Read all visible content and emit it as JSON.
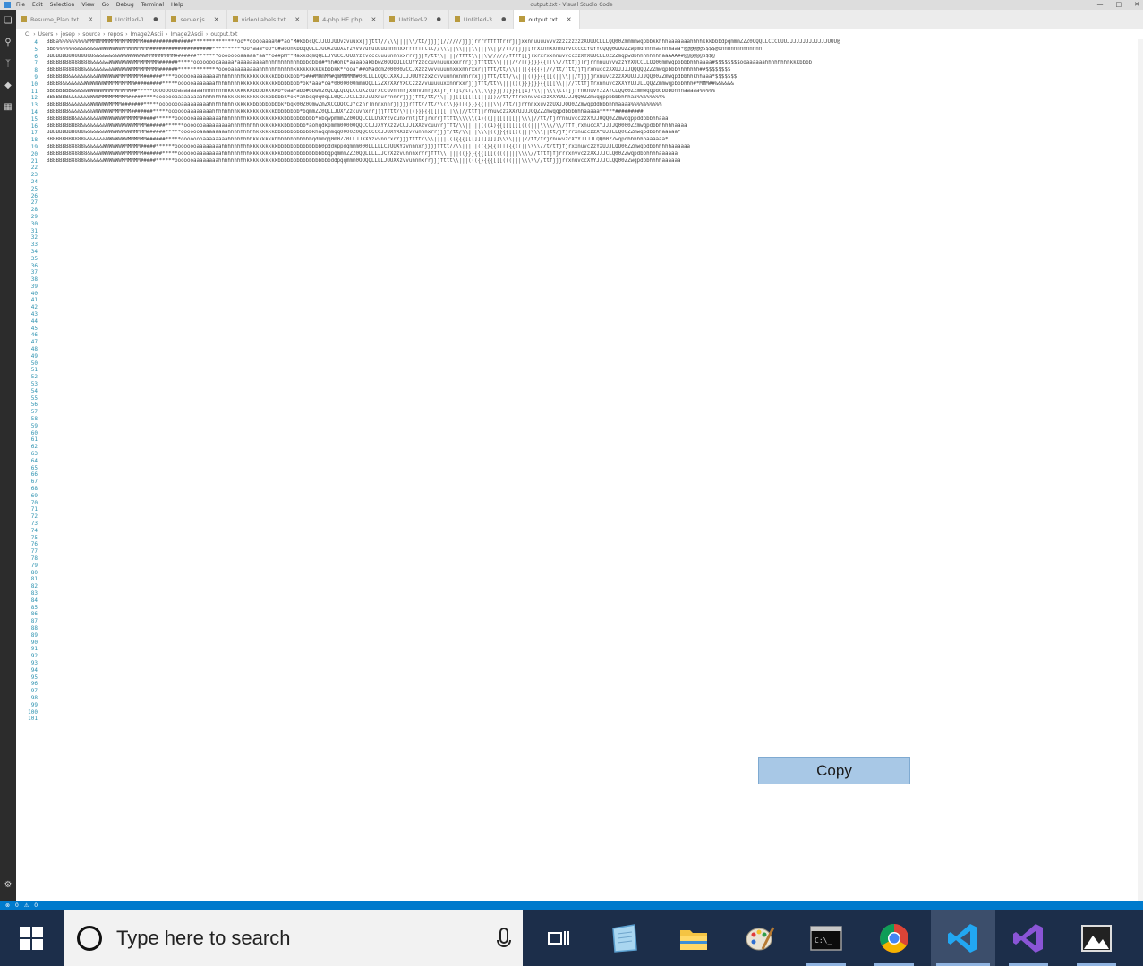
{
  "window": {
    "title": "output.txt - Visual Studio Code",
    "menu": [
      "File",
      "Edit",
      "Selection",
      "View",
      "Go",
      "Debug",
      "Terminal",
      "Help"
    ]
  },
  "tabs": [
    {
      "label": "Resume_Plan.txt",
      "state": "close"
    },
    {
      "label": "Untitled-1",
      "state": "dirty"
    },
    {
      "label": "server.js",
      "state": "close"
    },
    {
      "label": "videoLabels.txt",
      "state": "close"
    },
    {
      "label": "4-php HE.php",
      "state": "close"
    },
    {
      "label": "Untitled-2",
      "state": "dirty"
    },
    {
      "label": "Untitled-3",
      "state": "dirty"
    },
    {
      "label": "output.txt",
      "state": "active"
    }
  ],
  "breadcrumb": [
    "C:",
    "Users",
    "josep",
    "source",
    "repos",
    "Image2Ascii",
    "Image2Ascii",
    "output.txt"
  ],
  "editor": {
    "first_line": 4,
    "last_line": 101,
    "lines": [
      "BBBa%%%%%%%%%MMMMMMMMMMMMMMMMMM################**************oo**ooooaaaa%#*ao\"M#kbbcQCJJUJJUUvzvuuxxjjjttt//\\\\\\||||\\\\/tt/jjjj[//////jjjjrrrrfffffrrrjjjxxnnuuuuvvvzzzzzzzzzXUUUCLLLQQ00ZmmmmwqpbbkkhhhaaaaaaahhhhkkkbbbdpqmmmZZZ0OQQLLCCCUUUJJJJJJJJJJJJJUUU@",
      "BBB%%%%%%&&&&&&&&WWWWWWWMMMMMMMMM####################**********oo*aaa*oo*o#aoohkbbqQQLLJUUXzUUXXYzvvvvunuuuuunnnnxxrrrrffttt//\\\\\\||\\\\|||\\\\|||\\\\||//ff/jjjj[rrxxnnxxnnuvvcccccYUYYCQQQ0OOOZZwpmdhhhhaahhhaaa*@@@@@@$$$$@ohhhhhhhhhhhhh",
      "BBBBBBB88888888&&&&&&&&WWWWWWWWWMMMMMMMMM#######*******oooooooaaaaa*aa**o##pM\"*MaxkdqmQQLLJYUCCJUUXYzzvcccuuuunnnxxrrrjjjf/tt\\\\||||/ffft\\\\||\\\\//////ffff[[jrxrxrxxnnuvvcczzXYXUUCLL0Z2ZmqpwdbhhhhhhhhaaAAA##@@@@@@$$$@",
      "BBBBBBB8888888&&&&&&WWWWWWWWMMMMMMMM######*****ooooooooaaaaa*aaaaaaaaahhhhhhhhhhhbbbdbbd#*hh#ohk*aaaaoakbbwZ0OOQQLLCUYYzzccuvnuuuxxxrrrjjjffttt\\\\||||///[(}}}}{{[[\\\\//ttfjj[rjrrnnuuvvvzzYYXUCCLLQQ00mmwqpbbbbhhhaaaa#$$$$$$$$ooaaaaaahhhhhhhhkkkbbbb",
      "BBBBB8888888&&&&&&&&&WWWWWWMMMMMMMMM######*************ooooaaaaaaaaahhhhhhhhhhhkkkkkkkkkkbbbkk**ooa\"##oMaddm200000ZCCJXzzzvvvuuunnxxxnnrxxrjjfft/tt/\\\\||||{{{{{|///tt/jtt/jfjrxnucczXXUJJJJQQQQQZZZmwqpbbbhhhhhhh##$$$$$$$$",
      "BBBBBBB&&&&&&&&&WWWWWWWMMMMMMMM######****ooooooaaaaaaaahhhhhhhhkkkkkkkkkkbbbkkbbb*o###MOmMM#qmMMMMM#00LLLLQQCCXXXJJJJUUYzzxzcvvuunnxnnnrrxjjjfft/ttt/\\\\|||((}}{{[[(||\\\\||/fjjjjrxnuvczzzXXUUJJJJQQ00ZZmwqpdbbhhkhhaaa*$$$$$$$",
      "BBBB8&&&&&&&WWWWWWWMMMMMMMMM#########*****oooooaaaaaaahhhhhhhhkkkkkkkkkkkkbbbbbbb*ok*aaa*oa*0000000mmmOQLL2ZXYXXYYXCCzzzvvuuuuuxxnnrxxrjjjfft/tt\\\\|||(((}}}}}}{{[[[\\\\||//tttfjfrxnnuvczXXYYUJJLLQQZZmmwqpbbbhhh#*MMM##&&&&&&",
      "BBBBBBBB&&&&&WWWWWMMMMMMMMM##*****ooooooooaaaaaaaahhhhhhhhkkkkkkkkbbbbkkkkb*oaa*abo#obwm20QLQLQLQLCCUXzcurxccuvnnnr]xnnvunr]xxjrjrf]t/tf/\\\\(\\\\}}}|))}}}[[1)\\\\\\||\\\\\\\\ttf]jrrnxnuvYzzXYCLQQ00ZZmmwqqpddbbbbhhhaaaaa%%%%%",
      "BBBBBBB&&&&&&WWWWMMMMMMMMM#####****ooooooaaaaaaaaahhhhhhhhkkkkkkkkkkkkkbbbbbk*ok*ahbqq0q0qLL0QCJJCLLzJJuUXnurrnnrrjjjjfft/tt/\\\\|(}}[[[[[[[[||]])//tt/ffrxnnuvcczzXXYUUJJJQQ0ZZmwqqppbbbbhhhaa%%%%%%%%%",
      "BBBBBBB&&&&&&&WWWWWWMMMM#######*****oooooooaaaaaaaaahhhhhhhhkkkkkkbbbbbbbbbk*bqk00Z0OmwZmZXCCQQCCJYcznr]nnnxnnrjjjjjrfft//ft/\\\\(\\\\}}[[(}}}{{|||\\\\|/tt/jjrrnnxxuvzzUXJJQQ0ZZmwqpddbbbhhhaaaa%%%%%%%%%%",
      "BBBBBBB&&&&&&&&WWWWWWMMMMMM#######*****ooooooaaaaaaaahhhhhhhhkkkkkkkkkkkkbbbbbbbb*bqmmZZ0QLLJUXYZzcuvnxrr]jjfftt/\\\\|((}}}{{[[[[[||\\\\|//ttfjjrrnuvczzXXYUJJJQQZZZmwqqpdbbbhhhaaaaa*****#########",
      "BBBBBBBBB&&&&&&&&WWWWWWWWMMMMM#####******ooooooaaaaaaaaahhhhhhhhkkkkkkkkkkkkbbbbbbbbbb*obqwpmmmZZ00OQLCLLUYXYzvcunxrnt]tf]rxrrjftft\\\\\\\\\\\\(1)((]|[[[[[[||\\\\\\|//tt/fjrrnnuvcczzXYJJ0QQ0ZZmwqqppddbbbhhaaa",
      "BBBBBBBBBB8&&&&&&&&WWWWWWWWWMMMM######******ooooooaaaaaaaaahhhhhhhhhkkkkkkkkbbbbbbb*aohqdkpmmm00000QQCCCJJXYYXzzvCUJJLXXzvcuuvrjfft/\\\\|||||(((1){{[[[[[[(((|||\\\\\\\\/\\\\/fff[rxnuccXYJJJJQ0000ZZmwqpdbbhhhhhaaaa",
      "BBBBBBBBB888&&&&&&&WWWWWWWWMMMMM######*****ooooooaaaaaaaaahhhhhhhhhkkkkkkbbbbbbbbbbbbkhaqqmmqq0000Z0QQCCCCCJJUXYXXzzvvunnnxrrjjjf/tt/\\\\|||\\\\\\|((}}{{[[((|||\\\\\\\\||tt/jfjrrxnucczzXYUJJLLQ00ZZmwqpdbbhhaaaaa*",
      "BBBBBBBBB888&&&&&&&WWWWWWWMMMMMM######*****oooooooaaaaaaaahhhhhhhhkkkkkkkbbbbbbbbbbbbqdmmqq0m0ZZ0LLJJXXYzvvnnrxrrjjjfttt/\\\\\\||||((({{{[[[]]]]]]]]\\\\\\\\||||//tf/frjrnuvvzcXYYJJJJLQQ00ZZwqpdbbhhhhaaaaaa*",
      "BBBBBBB88888&&&&&&WWWWWWWMMMMM#####******oooooooaaaaaaaahhhhhhhhhkkkkkkkkkbbbbbbbbbbbbbb0pddkppdqmmm000LLLLLCJUUXYzvnnnxrjjjjfftt//\\\\|||||(({}{{[[[[{{((||\\\\\\\\//t/tfjfjrxxnuvczzYXUJJLQQ00ZZmwqpdbbhhhhhaaaaaa",
      "BBBBBBB888888&&&&WWWWWWWWMMMMMM######*****ooooooaaaaaaaahhhhhhhhhkkkkkkkkkkbbbbbbbbbbbbbbbqpqmmmZZZ0QQLLLLJJCYXzzvunnnxrrrjfft\\\\||||((}}}{{{[[[((((||||\\\\\\\\//tftfjfjrrrxnvvczzXXJJJCLQ00ZZwqpdbbhhhhaaaaaa",
      "BBBBBBBB8888&&&&&&WWWWWWMMMMMM#####******ooooooaaaaaaaahhhhhhhhhkkkkkkkkkkbbbbbbbbbbbbbbbbbddpqqmmm0OOQQLLLLJUUXXzvvunnnxrrjjjfttt\\\\|||((({}{{{[[[(((|||\\\\\\\\\\//ttfjjjrrxnuvccXYYJJJCLQQ00ZZwqpdbbhhhhaaaaaa"
    ]
  },
  "copy_button": {
    "label": "Copy"
  },
  "statusbar": {
    "errors": "0",
    "warnings": "0"
  },
  "taskbar": {
    "search_placeholder": "Type here to search",
    "apps": [
      "task-view",
      "notepad",
      "file-explorer",
      "paint",
      "command-prompt",
      "chrome",
      "vscode",
      "visual-studio",
      "photos"
    ]
  }
}
